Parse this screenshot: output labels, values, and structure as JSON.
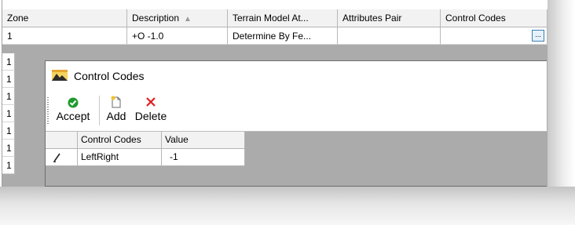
{
  "grid": {
    "columns": [
      "Zone",
      "Description",
      "Terrain Model At...",
      "Attributes Pair",
      "Control Codes"
    ],
    "row": {
      "zone": "1",
      "description": "+O -1.0",
      "terrain_model": "Determine By Fe...",
      "attributes_pair": "",
      "control_codes_button": "..."
    },
    "left_rows": [
      "1",
      "1",
      "1",
      "1",
      "1",
      "1",
      "1"
    ]
  },
  "dialog": {
    "title": "Control Codes",
    "toolbar": {
      "accept": "Accept",
      "add": "Add",
      "delete": "Delete"
    },
    "table": {
      "columns": [
        "Control Codes",
        "Value"
      ],
      "rows": [
        {
          "control_code": "LeftRight",
          "value": "-1"
        }
      ]
    }
  },
  "colors": {
    "accept": "#1f9a2e",
    "delete": "#e02020",
    "selection_border": "#3c7fb1"
  },
  "icons": {
    "title": "control-codes-window-icon",
    "accept": "checkmark-icon",
    "add": "new-document-icon",
    "delete": "x-icon",
    "row_edit": "pencil-icon"
  }
}
